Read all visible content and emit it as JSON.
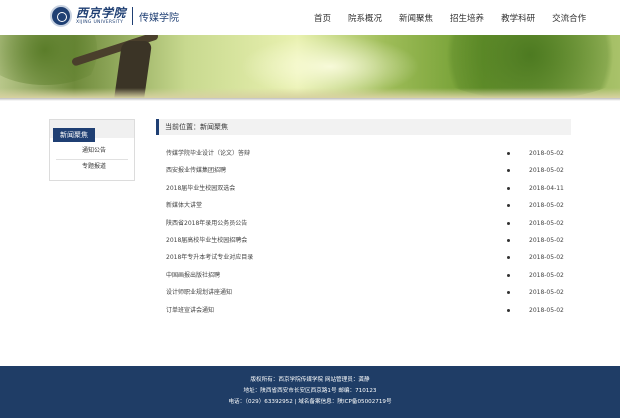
{
  "header": {
    "logo_cn": "西京学院",
    "logo_en": "XIJING UNIVERSITY",
    "school_name": "传媒学院",
    "nav": [
      "首页",
      "院系概况",
      "新闻聚焦",
      "招生培养",
      "教学科研",
      "交流合作"
    ]
  },
  "sidebar": {
    "title": "新闻聚焦",
    "items": [
      "通知公告",
      "专题报道"
    ]
  },
  "main": {
    "breadcrumb": "当前位置：新闻聚焦",
    "news": [
      {
        "title": "传媒学院毕业设计（论文）答辩",
        "date": "2018-05-02"
      },
      {
        "title": "西安报业传媒集团招聘",
        "date": "2018-05-02"
      },
      {
        "title": "2018届毕业生校园双选会",
        "date": "2018-04-11"
      },
      {
        "title": "新媒体大讲堂",
        "date": "2018-05-02"
      },
      {
        "title": "陕西省2018年录用公务员公告",
        "date": "2018-05-02"
      },
      {
        "title": "2018届高校毕业生校园招聘会",
        "date": "2018-05-02"
      },
      {
        "title": "2018年专升本考试专业对应目录",
        "date": "2018-05-02"
      },
      {
        "title": "中国画报出版社招聘",
        "date": "2018-05-02"
      },
      {
        "title": "设计师职业规划讲座通知",
        "date": "2018-05-02"
      },
      {
        "title": "订单班宣讲会通知",
        "date": "2018-05-02"
      }
    ]
  },
  "footer": {
    "line1": "版权所有：西京学院传媒学院 网站管理员：龚静",
    "line2": "地址：陕西省西安市长安区西京路1号 邮编：710123",
    "line3": "电话：（029）63392952 | 域名备案信息：陕ICP备05002719号"
  },
  "colors": {
    "brand_navy": "#1f3f73",
    "footer_bg": "#1f3d66"
  }
}
